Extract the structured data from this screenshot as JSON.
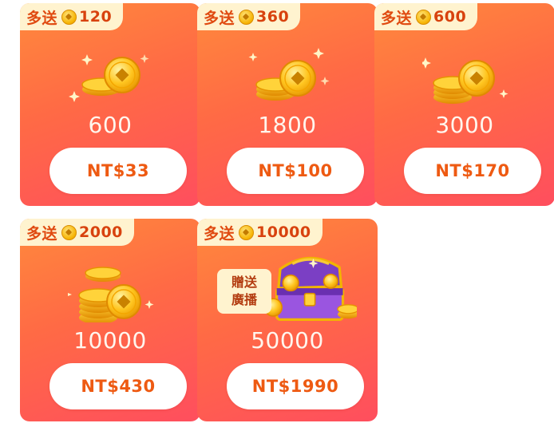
{
  "packages": [
    {
      "bonus_prefix": "多送",
      "bonus": "120",
      "amount": "600",
      "price": "NT$33"
    },
    {
      "bonus_prefix": "多送",
      "bonus": "360",
      "amount": "1800",
      "price": "NT$100"
    },
    {
      "bonus_prefix": "多送",
      "bonus": "600",
      "amount": "3000",
      "price": "NT$170"
    },
    {
      "bonus_prefix": "多送",
      "bonus": "2000",
      "amount": "10000",
      "price": "NT$430"
    },
    {
      "bonus_prefix": "多送",
      "bonus": "10000",
      "amount": "50000",
      "price": "NT$1990",
      "extra_line1": "贈送",
      "extra_line2": "廣播"
    }
  ]
}
